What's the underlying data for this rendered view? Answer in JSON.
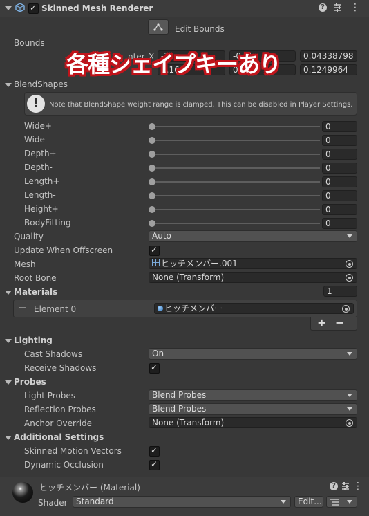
{
  "header": {
    "title": "Skinned Mesh Renderer"
  },
  "edit_bounds": {
    "label": "Edit Bounds"
  },
  "bounds": {
    "label": "Bounds",
    "center_partial": "nter",
    "row1": {
      "axis": "X",
      "v1": "-2",
      "v2": "-0.15",
      "v3": "0.04338798"
    },
    "row2": {
      "v1": "0.16",
      "v2": "0.36",
      "v3": "0.1249964"
    }
  },
  "overlay_banner": {
    "text": "各種シェイプキーあり"
  },
  "blendshapes": {
    "title": "BlendShapes",
    "note": "Note that BlendShape weight range is clamped. This can be disabled in Player Settings.",
    "items": [
      {
        "label": "Wide+",
        "value": "0",
        "level": 0
      },
      {
        "label": "Wide-",
        "value": "0",
        "level": 0
      },
      {
        "label": "Depth+",
        "value": "0",
        "level": 0
      },
      {
        "label": "Depth-",
        "value": "0",
        "level": 0
      },
      {
        "label": "Length+",
        "value": "0",
        "level": 0
      },
      {
        "label": "Length-",
        "value": "0",
        "level": 0
      },
      {
        "label": "Height+",
        "value": "0",
        "level": 0
      },
      {
        "label": "BodyFitting",
        "value": "0",
        "level": 0
      }
    ]
  },
  "quality": {
    "label": "Quality",
    "value": "Auto"
  },
  "update_offscreen": {
    "label": "Update When Offscreen",
    "checked": true
  },
  "mesh": {
    "label": "Mesh",
    "value": "ヒッチメンバー.001"
  },
  "root_bone": {
    "label": "Root Bone",
    "value": "None (Transform)"
  },
  "materials": {
    "title": "Materials",
    "count": "1",
    "element_label": "Element 0",
    "element_value": "ヒッチメンバー",
    "add": "+",
    "remove": "−"
  },
  "lighting": {
    "title": "Lighting",
    "cast_shadows_label": "Cast Shadows",
    "cast_shadows_value": "On",
    "receive_shadows_label": "Receive Shadows",
    "receive_shadows_checked": true
  },
  "probes": {
    "title": "Probes",
    "light_label": "Light Probes",
    "light_value": "Blend Probes",
    "reflection_label": "Reflection Probes",
    "reflection_value": "Blend Probes",
    "anchor_label": "Anchor Override",
    "anchor_value": "None (Transform)"
  },
  "additional": {
    "title": "Additional Settings",
    "motion_label": "Skinned Motion Vectors",
    "motion_checked": true,
    "occlusion_label": "Dynamic Occlusion",
    "occlusion_checked": true
  },
  "material_footer": {
    "name": "ヒッチメンバー (Material)",
    "shader_label": "Shader",
    "shader_value": "Standard",
    "edit_label": "Edit..."
  },
  "icons": [
    "cube-icon",
    "help-icon",
    "preset-icon",
    "more-icon",
    "warning-icon",
    "object-picker-icon",
    "mesh-icon",
    "material-icon",
    "drag-handle-icon",
    "dropdown-arrow-icon",
    "list-icon"
  ]
}
